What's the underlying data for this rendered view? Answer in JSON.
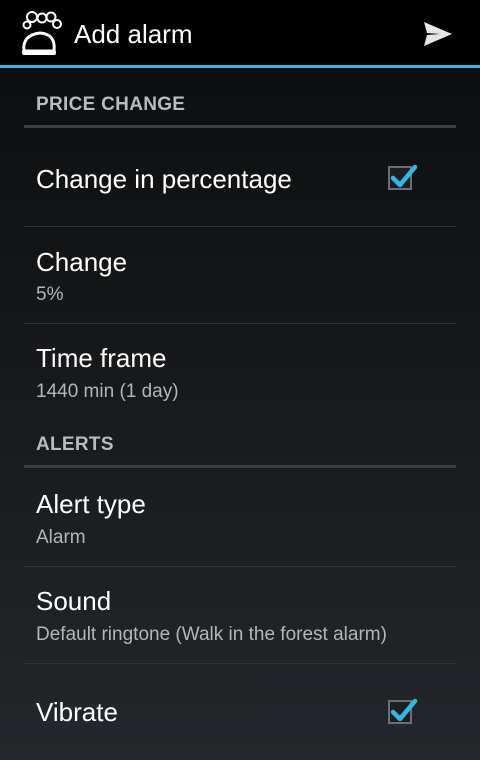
{
  "action_bar": {
    "title": "Add alarm",
    "icons": {
      "app": "alarm-bells-icon",
      "send": "send-icon"
    }
  },
  "sections": {
    "price_change": {
      "header": "PRICE CHANGE"
    },
    "alerts": {
      "header": "ALERTS"
    }
  },
  "preferences": {
    "change_in_percentage": {
      "title": "Change in percentage",
      "checked": true
    },
    "change": {
      "title": "Change",
      "summary": "5%"
    },
    "time_frame": {
      "title": "Time frame",
      "summary": "1440 min (1 day)"
    },
    "alert_type": {
      "title": "Alert type",
      "summary": "Alarm"
    },
    "sound": {
      "title": "Sound",
      "summary": "Default ringtone (Walk in the forest alarm)"
    },
    "vibrate": {
      "title": "Vibrate",
      "checked": true
    }
  },
  "colors": {
    "accent": "#33b5e5",
    "header_text": "#b8bcc0",
    "summary_text": "#b3b6b9"
  }
}
